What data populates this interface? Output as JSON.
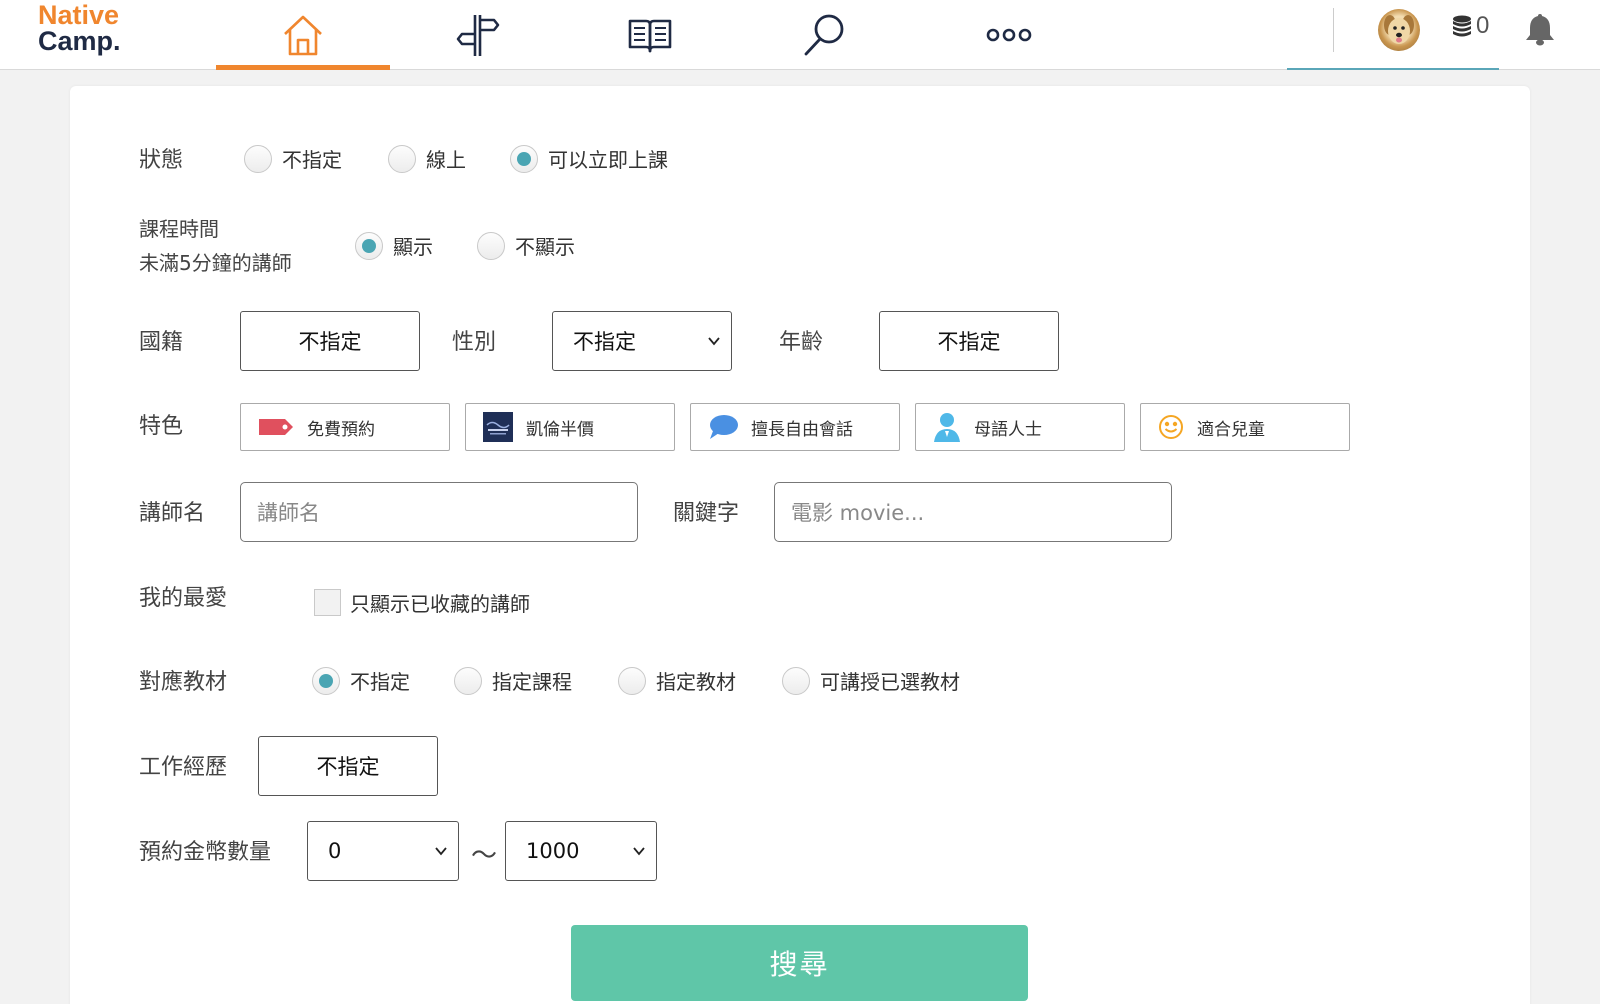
{
  "header": {
    "logo_line1": "Native",
    "logo_line2": "Camp.",
    "nav": [
      {
        "icon": "home-icon",
        "active": true
      },
      {
        "icon": "signpost-icon",
        "active": false
      },
      {
        "icon": "book-icon",
        "active": false
      },
      {
        "icon": "search-icon",
        "active": false
      },
      {
        "icon": "more-icon",
        "active": false
      }
    ],
    "coins": "0",
    "accent": "#f0862e"
  },
  "form": {
    "status": {
      "label": "狀態",
      "options": [
        "不指定",
        "線上",
        "可以立即上課"
      ],
      "selected": 2
    },
    "short_lesson": {
      "label_line1": "課程時間",
      "label_line2": "未滿5分鐘的講師",
      "options": [
        "顯示",
        "不顯示"
      ],
      "selected": 0
    },
    "nationality": {
      "label": "國籍",
      "value": "不指定"
    },
    "gender": {
      "label": "性別",
      "value": "不指定"
    },
    "age": {
      "label": "年齡",
      "value": "不指定"
    },
    "features": {
      "label": "特色",
      "items": [
        {
          "label": "免費預約",
          "icon": "tag-icon"
        },
        {
          "label": "凱倫半價",
          "icon": "karen-icon"
        },
        {
          "label": "擅長自由會話",
          "icon": "speech-bubble-icon"
        },
        {
          "label": "母語人士",
          "icon": "person-icon"
        },
        {
          "label": "適合兒童",
          "icon": "smiley-icon"
        }
      ]
    },
    "teacher_name": {
      "label": "講師名",
      "placeholder": "講師名"
    },
    "keyword": {
      "label": "關鍵字",
      "placeholder": "電影 movie..."
    },
    "favorite": {
      "label": "我的最愛",
      "checkbox_label": "只顯示已收藏的講師",
      "checked": false
    },
    "material": {
      "label": "對應教材",
      "options": [
        "不指定",
        "指定課程",
        "指定教材",
        "可講授已選教材"
      ],
      "selected": 0
    },
    "experience": {
      "label": "工作經歷",
      "value": "不指定"
    },
    "coins_range": {
      "label": "預約金幣數量",
      "min": "0",
      "separator": "〜",
      "max": "1000"
    },
    "search_button": "搜尋",
    "search_color": "#5fc6a8",
    "radio_color": "#4aa5b3"
  }
}
